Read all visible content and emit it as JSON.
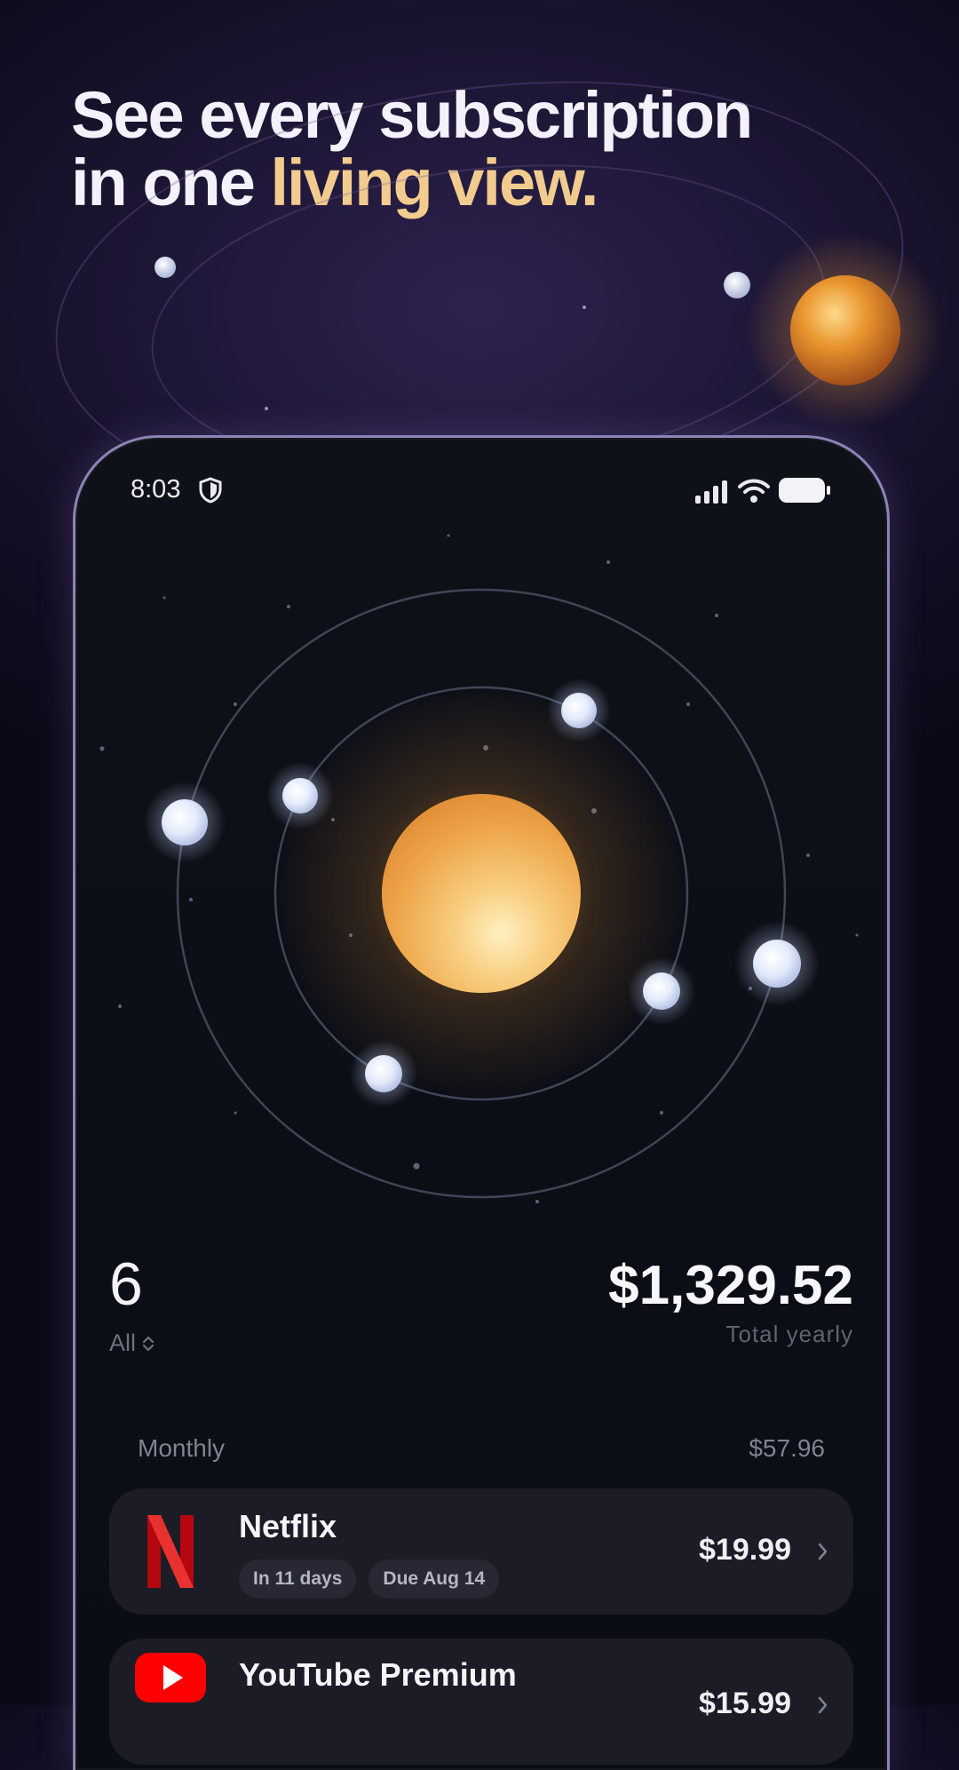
{
  "headline": {
    "line1": "See every subscription",
    "line2_prefix": "in one ",
    "line2_accent": "living view."
  },
  "colors": {
    "accent": "#f2cc8f",
    "sun": "#f0a848",
    "planet": "#dfe8ff",
    "card": "#1b1c25",
    "netflix_red": "#e50914",
    "youtube_red": "#ff0000"
  },
  "status_bar": {
    "time": "8:03",
    "icons": [
      "shield-icon",
      "signal-icon",
      "wifi-icon",
      "battery-icon"
    ]
  },
  "summary": {
    "count": "6",
    "filter_label": "All",
    "total": "$1,329.52",
    "total_label": "Total yearly"
  },
  "section": {
    "title": "Monthly",
    "amount": "$57.96"
  },
  "subscriptions": [
    {
      "name": "Netflix",
      "logo": "netflix-logo",
      "chips": [
        "In 11 days",
        "Due Aug 14"
      ],
      "price": "$19.99"
    },
    {
      "name": "YouTube Premium",
      "logo": "youtube-logo",
      "chips": [],
      "price": "$15.99"
    }
  ]
}
